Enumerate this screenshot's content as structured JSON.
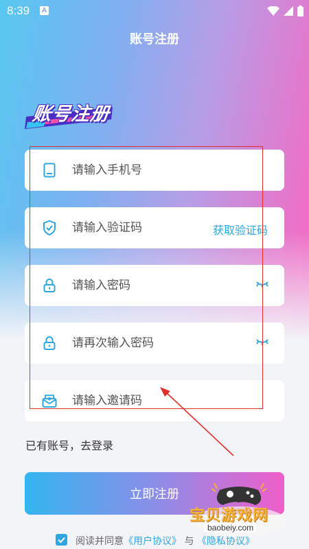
{
  "status_bar": {
    "time": "8:39",
    "badge": "A"
  },
  "header": {
    "title": "账号注册"
  },
  "logo": {
    "text": "账号注册"
  },
  "form": {
    "phone_placeholder": "请输入手机号",
    "code_placeholder": "请输入验证码",
    "get_code_label": "获取验证码",
    "password_placeholder": "请输入密码",
    "confirm_password_placeholder": "请再次输入密码",
    "invite_placeholder": "请输入邀请码"
  },
  "login_link": "已有账号，去登录",
  "register_button": "立即注册",
  "agreement": {
    "prefix": "阅读并同意",
    "user_agreement": "《用户协议》",
    "and": "与",
    "privacy_policy": "《隐私协议》",
    "checked": true
  },
  "watermark": {
    "title": "宝贝游戏网",
    "url": "baobeiy.com"
  },
  "colors": {
    "accent": "#2fa6e0",
    "annotation": "#e0302b"
  }
}
